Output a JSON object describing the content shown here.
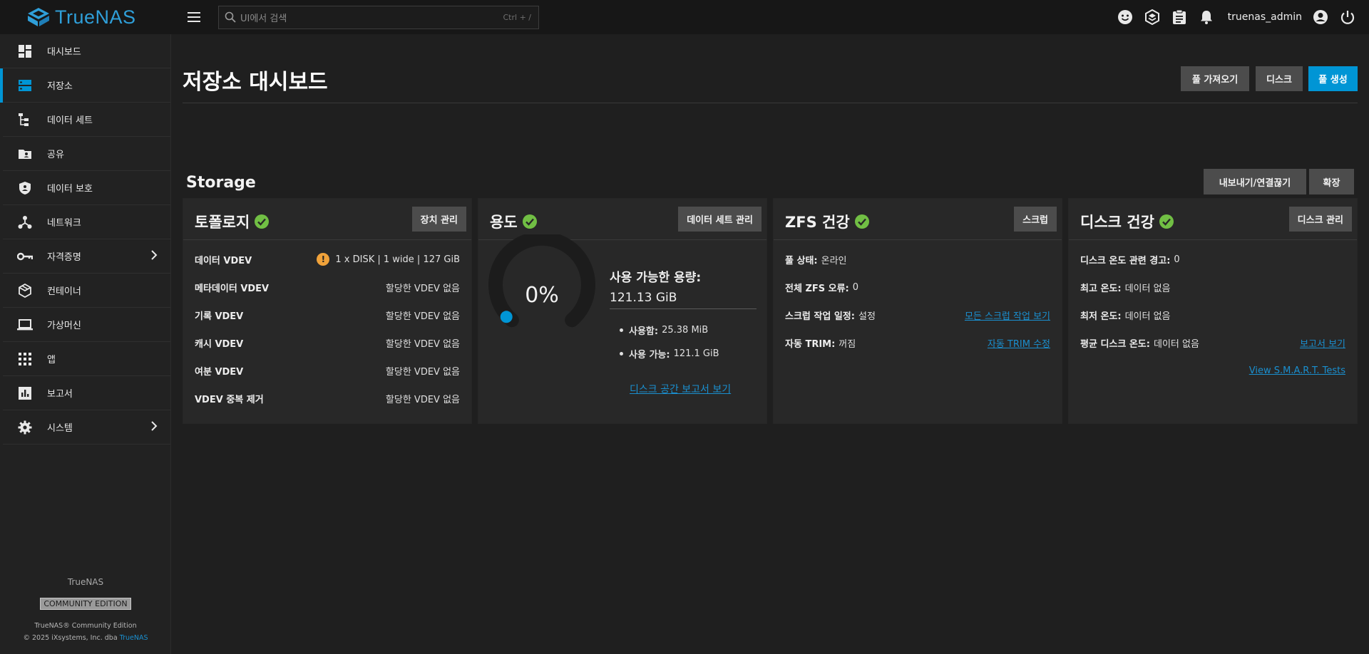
{
  "app": {
    "logo_text": "TrueNAS",
    "username": "truenas_admin"
  },
  "search": {
    "placeholder": "UI에서 검색",
    "shortcut": "Ctrl + /"
  },
  "sidebar": {
    "items": [
      {
        "label": "대시보드",
        "icon": "dashboard-icon"
      },
      {
        "label": "저장소",
        "icon": "storage-icon",
        "active": true
      },
      {
        "label": "데이터 세트",
        "icon": "datasets-icon"
      },
      {
        "label": "공유",
        "icon": "shares-icon"
      },
      {
        "label": "데이터 보호",
        "icon": "data-protection-icon"
      },
      {
        "label": "네트워크",
        "icon": "network-icon"
      },
      {
        "label": "자격증명",
        "icon": "key-icon",
        "expandable": true
      },
      {
        "label": "컨테이너",
        "icon": "containers-icon"
      },
      {
        "label": "가상머신",
        "icon": "laptop-icon"
      },
      {
        "label": "앱",
        "icon": "apps-grid-icon"
      },
      {
        "label": "보고서",
        "icon": "reports-icon"
      },
      {
        "label": "시스템",
        "icon": "gear-icon",
        "expandable": true
      }
    ],
    "footer": {
      "brand": "TrueNAS",
      "edition": "COMMUNITY EDITION",
      "copyright_line1": "TrueNAS® Community Edition",
      "copyright_line2": "© 2025 iXsystems, Inc. dba",
      "copyright_link": "TrueNAS"
    }
  },
  "page": {
    "title": "저장소 대시보드",
    "buttons": {
      "import_pool": "풀 가져오기",
      "disks": "디스크",
      "create_pool": "풀 생성"
    }
  },
  "storage": {
    "title": "Storage",
    "buttons": {
      "export": "내보내기/연결끊기",
      "expand": "확장"
    }
  },
  "topology": {
    "title": "토폴로지",
    "button": "장치 관리",
    "rows": [
      {
        "label": "데이터 VDEV",
        "value": "1 x DISK | 1 wide | 127 GiB",
        "warning": true
      },
      {
        "label": "메타데이터 VDEV",
        "value": "할당한 VDEV 없음"
      },
      {
        "label": "기록 VDEV",
        "value": "할당한 VDEV 없음"
      },
      {
        "label": "캐시 VDEV",
        "value": "할당한 VDEV 없음"
      },
      {
        "label": "여분 VDEV",
        "value": "할당한 VDEV 없음"
      },
      {
        "label": "VDEV 중복 제거",
        "value": "할당한 VDEV 없음"
      }
    ]
  },
  "usage": {
    "title": "용도",
    "button": "데이터 세트 관리",
    "percent": "0%",
    "percent_value": 0,
    "available_label": "사용 가능한 용량:",
    "available_value": "121.13 GiB",
    "used_label": "사용함:",
    "used_value": "25.38 MiB",
    "free_label": "사용 가능:",
    "free_value": "121.1 GiB",
    "link": "디스크 공간 보고서 보기"
  },
  "zfs_health": {
    "title": "ZFS 건강",
    "button": "스크럽",
    "pool_status_label": "풀 상태:",
    "pool_status_value": "온라인",
    "errors_label": "전체 ZFS 오류:",
    "errors_value": "0",
    "scrub_label": "스크럽 작업 일정:",
    "scrub_value": "설정",
    "scrub_link": "모든 스크럽 작업 보기",
    "trim_label": "자동 TRIM:",
    "trim_value": "꺼짐",
    "trim_link": "자동 TRIM 수정"
  },
  "disk_health": {
    "title": "디스크 건강",
    "button": "디스크 관리",
    "temp_alerts_label": "디스크 온도 관련 경고:",
    "temp_alerts_value": "0",
    "max_temp_label": "최고 온도:",
    "max_temp_value": "데이터 없음",
    "min_temp_label": "최저 온도:",
    "min_temp_value": "데이터 없음",
    "avg_temp_label": "평균 디스크 온도:",
    "avg_temp_value": "데이터 없음",
    "reports_link": "보고서 보기",
    "smart_link": "View S.M.A.R.T. Tests"
  },
  "colors": {
    "accent": "#0095d5",
    "ok": "#71bf44",
    "warning": "#f0a23a",
    "link": "#1a8fcf"
  }
}
